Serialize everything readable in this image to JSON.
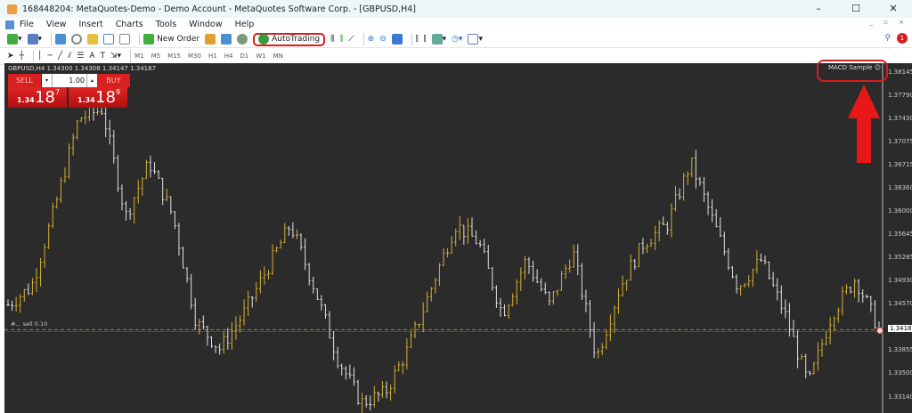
{
  "window": {
    "title": "168448204: MetaQuotes-Demo - Demo Account - MetaQuotes Software Corp. - [GBPUSD,H4]",
    "minimize": "–",
    "maximize": "☐",
    "close": "✕"
  },
  "menu": [
    "File",
    "View",
    "Insert",
    "Charts",
    "Tools",
    "Window",
    "Help"
  ],
  "toolbar": {
    "new_order": "New Order",
    "autotrading": "AutoTrading",
    "notification_count": "1"
  },
  "timeframes": [
    "M1",
    "M5",
    "M15",
    "M30",
    "H1",
    "H4",
    "D1",
    "W1",
    "MN"
  ],
  "chart": {
    "symbol_info": "GBPUSD,H4  1.34300 1.34308 1.34147 1.34187",
    "expert": "MACD Sample ☺",
    "sell_label": "SELL",
    "buy_label": "BUY",
    "lot": "1.00",
    "sell_small": "1.34",
    "sell_big": "18",
    "sell_exp": "7",
    "buy_small": "1.34",
    "buy_big": "18",
    "buy_exp": "9",
    "order_line": "#... sell 0.10",
    "current_price": "1.34187",
    "price_labels": [
      "1.38145",
      "1.37790",
      "1.37430",
      "1.37075",
      "1.36715",
      "1.36360",
      "1.36000",
      "1.35645",
      "1.35285",
      "1.34930",
      "1.34570",
      "1.34187",
      "1.33855",
      "1.33500",
      "1.33140"
    ],
    "price_range": [
      1.329,
      1.383
    ],
    "path_prices": [
      1.3457,
      1.3485,
      1.3608,
      1.3745,
      1.3759,
      1.3594,
      1.3677,
      1.3594,
      1.343,
      1.3389,
      1.3443,
      1.3512,
      1.3581,
      1.3485,
      1.3375,
      1.3306,
      1.332,
      1.3389,
      1.3485,
      1.3581,
      1.3553,
      1.3443,
      1.3526,
      1.3457,
      1.3539,
      1.3375,
      1.3485,
      1.3553,
      1.3581,
      1.3677,
      1.3581,
      1.3485,
      1.3526,
      1.3443,
      1.3334,
      1.3443,
      1.3498,
      1.3419
    ],
    "colors": {
      "up": "#d4b030",
      "down": "#e0e0e0",
      "bg": "#2b2b2b",
      "accent": "#d62020"
    }
  }
}
